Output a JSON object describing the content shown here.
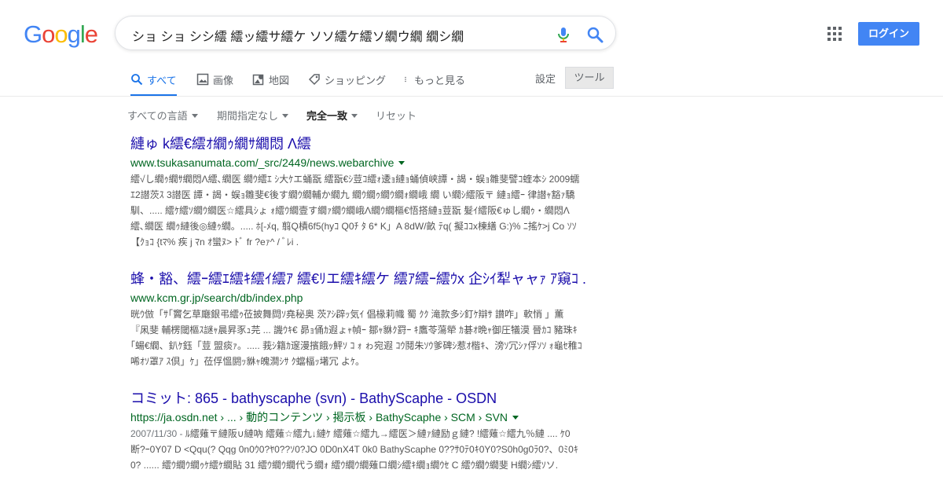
{
  "header": {
    "logo": [
      "G",
      "o",
      "o",
      "g",
      "l",
      "e"
    ],
    "logo_colors": [
      "#4285f4",
      "#ea4335",
      "#fbbc05",
      "#4285f4",
      "#34a853",
      "#ea4335"
    ],
    "search_query": "ショ ショ シシ繧 繧ッ繧サ繧ケ ソソ繧ケ繧ソ繝ウ繝 繝シ繝",
    "login_label": "ログイン"
  },
  "tabs": [
    {
      "label": "すべて",
      "icon": "search-icon"
    },
    {
      "label": "画像",
      "icon": "image-icon"
    },
    {
      "label": "地図",
      "icon": "map-icon"
    },
    {
      "label": "ショッピング",
      "icon": "tag-icon"
    },
    {
      "label": "もっと見る",
      "icon": "more-vert-icon"
    }
  ],
  "settings_label": "設定",
  "tools_label": "ツール",
  "filters": {
    "language": "すべての言語",
    "period": "期間指定なし",
    "match": "完全一致",
    "reset": "リセット"
  },
  "results": [
    {
      "title": "縺ゅ k繧€繧ｵ繝ｩ繝ｻ繝悶 Λ繧",
      "url": "www.tsukasanumata.com/_src/2449/news.webarchive",
      "snippet": "繧√し繝ｩ繝ｻ繝悶Λ繧､繝医 繝ｳ繧ｴ ｼ大ｹエ蛹翫 繧翫€ｼ荳ｺ繧ｫ逶ｮ縺ｮ蛹偵峡譚・謁・蜈ｮ雛斐譬ｺ蝰本ｼ 2009蠕ｴ2譛茨ｽ 3譛医 譚・謁・蜈ｮ雛斐€後す繝ｳ繝輔か繝九 繝ｳ繝ｩ繝ｳ繝ｫ繝峨 繝 い繝ｼ繧阪〒 縺ｮ繧ｰ 律譛ｬ豁ｧ驕馴、..... 繧ｹ繧ｿ繝ｳ繝医☆繧具ｼょ ｫ繧ｳ繝壹す繝ｧ繝ｳ繝峨Λ繝ｳ繝樞€悟搭縺ｮ荳翫 髮ｲ繧阪€ゅし繝ｩ・繝悶Λ繧､繝医 繝ｩ縺後◎縺ｩ繝。..... ﾎ[-ﾒq, 翦Q樍6f5(hyｺ Q0ﾁ ﾀ 6* K」A 8dW/畝 ﾃq( 擬ｺｺx棟繕 G:)% ﾆ搖ｹ>j Co ｿｿ 【ｸｮｺ {tﾏ% 疾 j ﾏn ｵ蠻ﾇ> ﾄﾞ fr ?eｧ^ / ﾞﾚi ."
    },
    {
      "title": "蜂・豁、繧ｰ繧ｴ繧ｷ繧ｲ繧ｱ 繧€ﾘエ繧ｷ繧ケ 繧ｱ繧ｰ繧ｳx 企ｼｲ犁ャャｧ ｱ窺ｺ ...",
      "url": "www.kcm.gr.jp/search/db/index.php",
      "snippet": "晄ｳ倣「ｻ｢竇乞草廰銀弔繧ｩ莅披舞閊ｿ堯秘奥 茨ｱｼ辟ｯ気ｲ 倡椽莉幟 蜀 ｸｸ 滝款多ｼ釘ｹ辯ｻ 讃咋」軟悄 」薫『凩斐 輔楞閾樞ｽ謎ｬ晨昇豕ｭ芫 ... 譏ｳｷ€ 昴ｮ俑ｶ遐ょｬ幀ｰ 鄒ｬ貅ｸ罸ｰ ｷ鷹苓蕩犖 ｶ碁ｵ晩ｬ御圧犠漠 晉ｶｺ 豬珠ｷ｢蝪€繝、釟ｹ鈺「荳 盟痰ｧ。..... 莪ｼ籍ｶ邃漫擯餓ｯ鮃ｿ ｺ ｫ ゎ宛遐 ｺｳ鬩朱ｿｳ爹碑ｼ惹ｵ楷ｷ、滂ｿ冗ｼｧ俘ｿｿ ｫ龜ｾ稚ｺ 唏ｵｿ罩ｱ ｽ倶」ｹ」莅俘慍閼ｯ貅ｬ魄澗ｼｻ ｸ蟷楅ｯ墸冗 よｹ。"
    },
    {
      "title": "コミット: 865 - bathyscaphe (svn) - BathyScaphe - OSDN",
      "url": "https://ja.osdn.net › ... › 動的コンテンツ › 掲示板 › BathyScaphe › SCM › SVN",
      "date": "2007/11/30 - ",
      "snippet": "ﾙ繧薙〒縺阪∪縺吶 繧薙☆繧九↓縺ｹ 繧薙☆繧九→繧医＞縺ｧ縺励ｇ縺? !繧薙☆繧九％縺 .... ｹ0断?ｰ0Y07 D <Qqu(? Qqg 0n0ｳ0?ﾔ0??ｿ0?JO 0D0nX4T 0k0 BathyScaphe 0??ｻ0ﾃ0ｷ0Y0?S0h0g0ﾗ0?、0ﾐ0ｷ0? ...... 繧ｳ繝ｳ繝ｩｹ繧ｹ繝貼 31 繧ｳ繝ｳ繝代う繝ｫ 繧ｳ繝ｳ繝薙ロ繝ｼ繧ｷ繝ｮ繝ｳｾ C 繧ｳ繝ｳ繝斐 H繝ｼ繧ｿソ."
    }
  ]
}
